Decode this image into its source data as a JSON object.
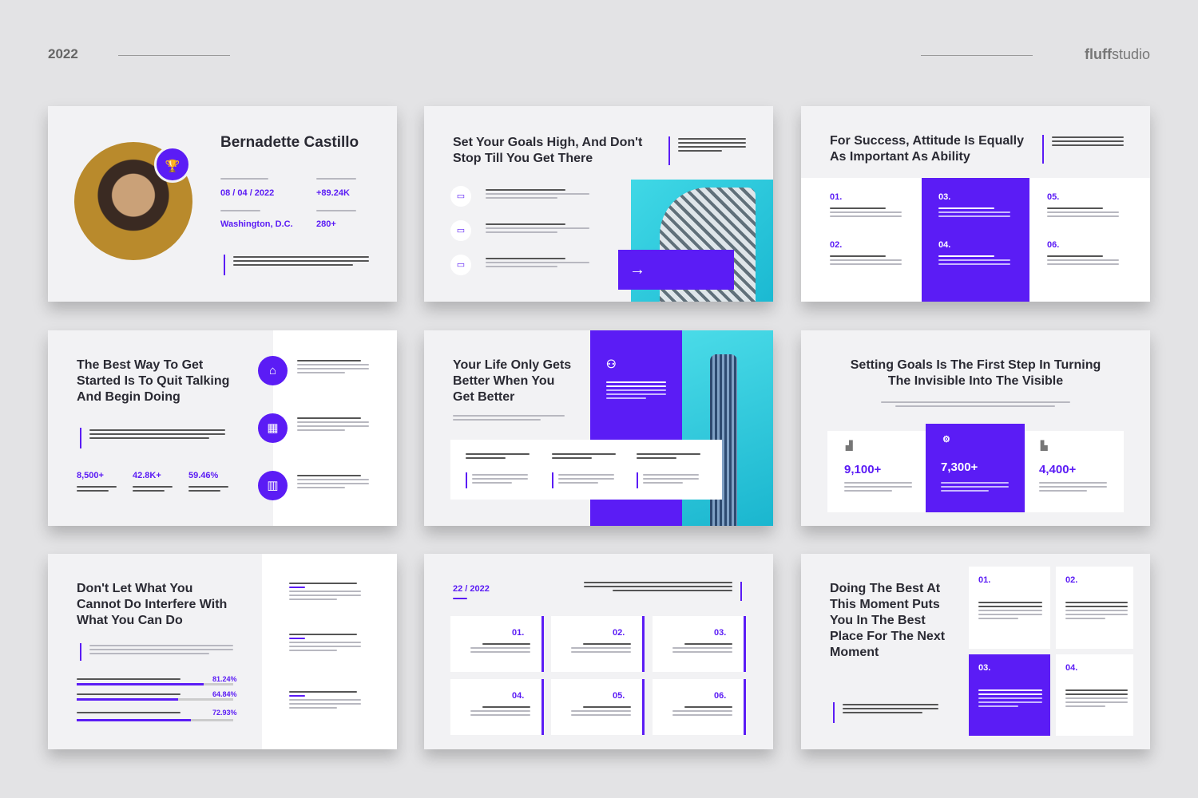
{
  "header": {
    "year": "2022",
    "brand_bold": "fluff",
    "brand_rest": "studio"
  },
  "s1": {
    "title": "Bernadette Castillo",
    "date": "08 / 04 / 2022",
    "stat1": "+89.24K",
    "city": "Washington, D.C.",
    "stat2": "280+"
  },
  "s2": {
    "title": "Set Your Goals High, And Don't Stop Till You Get There"
  },
  "s3": {
    "title": "For Success, Attitude Is Equally As Important As Ability",
    "nums": [
      "01.",
      "02.",
      "03.",
      "04.",
      "05.",
      "06."
    ]
  },
  "s4": {
    "title": "The Best Way To Get Started Is To Quit Talking And Begin Doing",
    "stats": [
      "8,500+",
      "42.8K+",
      "59.46%"
    ]
  },
  "s5": {
    "title": "Your Life Only Gets Better When You Get Better"
  },
  "s6": {
    "title": "Setting Goals Is The First Step In Turning The Invisible Into The Visible",
    "stats": [
      "9,100+",
      "7,300+",
      "4,400+"
    ]
  },
  "s7": {
    "title": "Don't Let What You Cannot Do Interfere With What You Can Do",
    "pct": [
      "81.24%",
      "64.84%",
      "72.93%"
    ],
    "fill": [
      0.81,
      0.65,
      0.73
    ]
  },
  "s8": {
    "date": "22 / 2022",
    "nums": [
      "01.",
      "02.",
      "03.",
      "04.",
      "05.",
      "06."
    ]
  },
  "s9": {
    "title": "Doing The Best At This Moment Puts You In The Best Place For The Next Moment",
    "nums": [
      "01.",
      "02.",
      "03.",
      "04."
    ]
  },
  "icons": {
    "trophy": "trophy-icon",
    "arrow": "arrow-right-icon"
  }
}
